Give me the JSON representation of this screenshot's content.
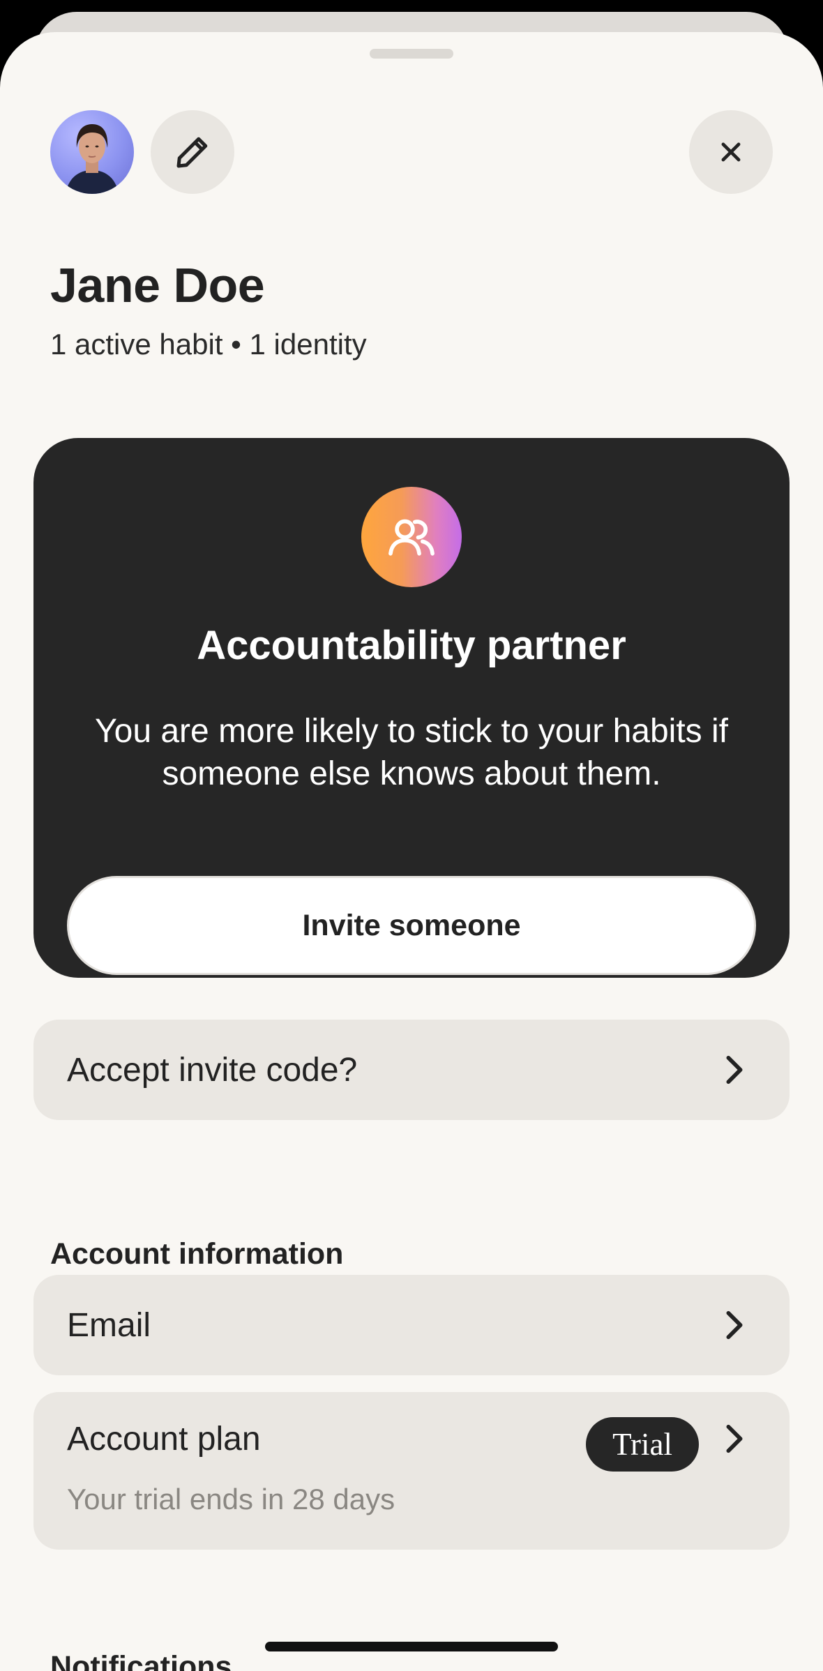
{
  "colors": {
    "background": "#f9f7f3",
    "card_dark": "#262626",
    "row_background": "#eae7e2",
    "text_primary": "#222222",
    "text_secondary": "#8a8782",
    "icon_gradient_start": "#ffa63d",
    "icon_gradient_end": "#c46de8"
  },
  "header": {
    "avatar_icon": "user-avatar-photo",
    "edit_icon": "pencil-icon",
    "close_icon": "close-icon"
  },
  "profile": {
    "name": "Jane Doe",
    "stats": "1 active habit • 1 identity"
  },
  "partner_card": {
    "icon": "people-icon",
    "title": "Accountability partner",
    "description": "You are more likely to stick to your habits if someone else knows about them.",
    "button_label": "Invite someone"
  },
  "invite_code": {
    "label": "Accept invite code?",
    "icon": "chevron-right-icon"
  },
  "account": {
    "section_title": "Account information",
    "email_label": "Email",
    "plan_label": "Account plan",
    "plan_badge": "Trial",
    "plan_subtitle": "Your trial ends in 28 days"
  },
  "notifications": {
    "section_title": "Notifications"
  }
}
